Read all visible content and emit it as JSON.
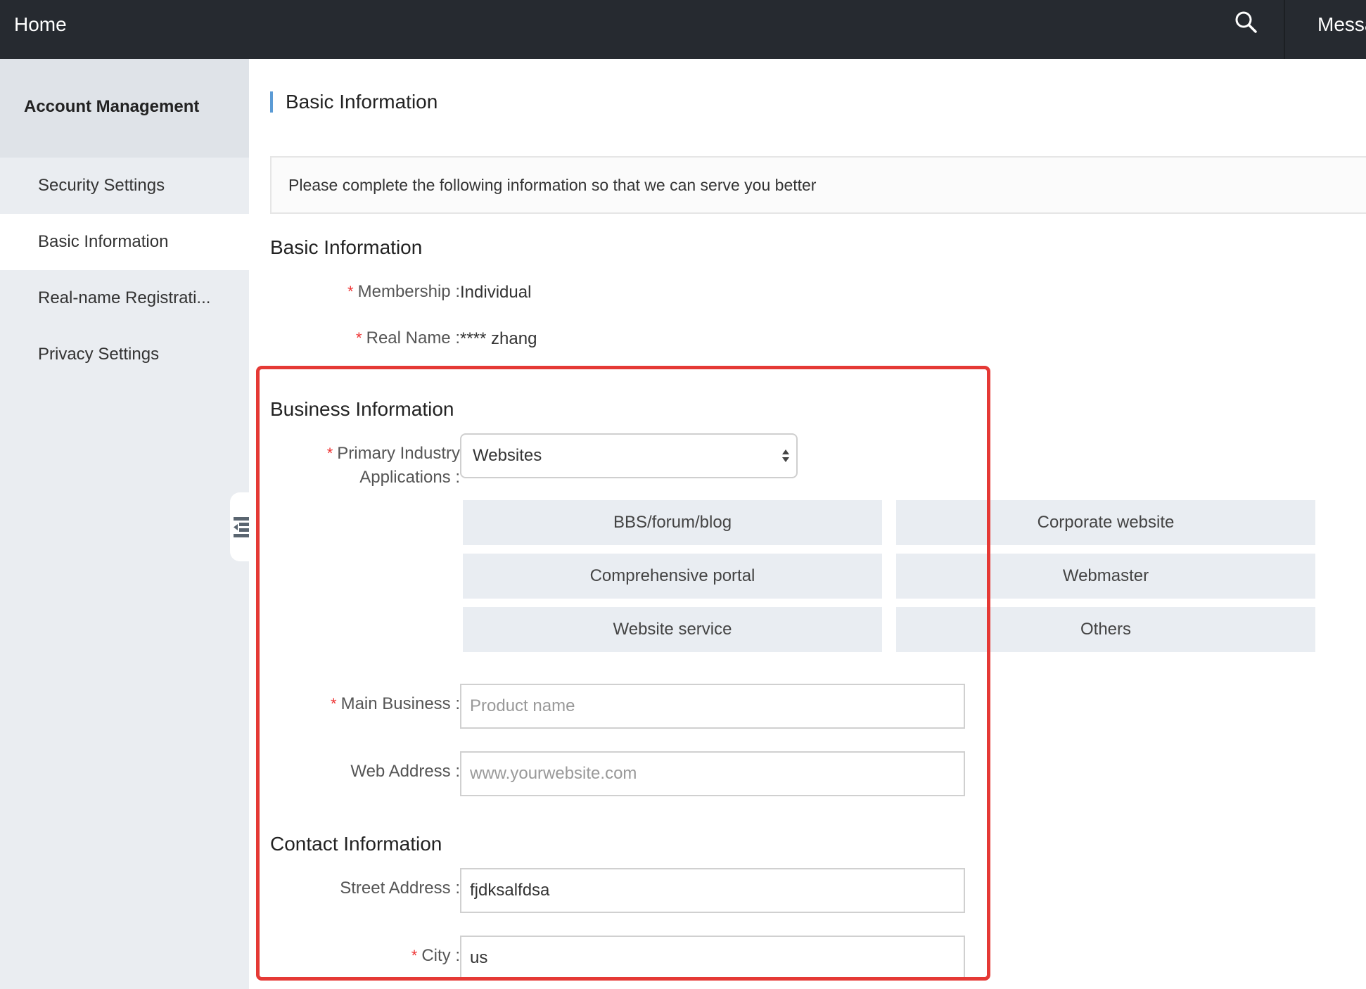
{
  "topbar": {
    "home": "Home",
    "messages": "Messages",
    "search_icon": "search-icon",
    "color": "#262a30"
  },
  "sidebar": {
    "heading": "Account Management",
    "items": [
      {
        "label": "Security Settings",
        "active": false
      },
      {
        "label": "Basic Information",
        "active": true
      },
      {
        "label": "Real-name Registrati...",
        "active": false
      },
      {
        "label": "Privacy Settings",
        "active": false
      }
    ],
    "collapse_icon": "collapse-sidebar-icon"
  },
  "main": {
    "page_title": "Basic Information",
    "notice": "Please complete the following information so that we can serve you better",
    "basic": {
      "title": "Basic Information",
      "membership_label": "Membership :",
      "membership_value": "Individual",
      "real_name_label": "Real Name :",
      "real_name_value": "**** zhang"
    },
    "business": {
      "title": "Business Information",
      "industry_label_line1": "Primary Industry",
      "industry_label_line2": "Applications :",
      "industry_selected": "Websites",
      "options": [
        "BBS/forum/blog",
        "Corporate website",
        "Comprehensive portal",
        "Webmaster",
        "Website service",
        "Others"
      ],
      "main_business_label": "Main Business :",
      "main_business_placeholder": "Product name",
      "web_address_label": "Web Address :",
      "web_address_placeholder": "www.yourwebsite.com"
    },
    "contact": {
      "title": "Contact Information",
      "street_label": "Street Address :",
      "street_value": "fjdksalfdsa",
      "city_label": "City :",
      "city_value": "us"
    },
    "required_mark": "*"
  },
  "colors": {
    "accent": "#5b9bd5",
    "required": "#ee3333",
    "highlight": "#e53935"
  }
}
